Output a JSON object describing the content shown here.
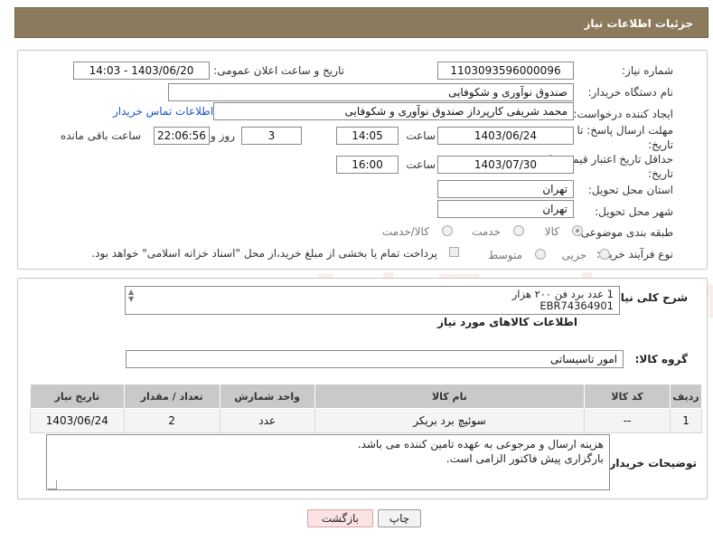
{
  "header": {
    "title": "جزئیات اطلاعات نیاز"
  },
  "form": {
    "need_number_label": "شماره نیاز:",
    "need_number": "1103093596000096",
    "announce_label": "تاریخ و ساعت اعلان عمومی:",
    "announce_value": "1403/06/20 - 14:03",
    "buyer_org_label": "نام دستگاه خریدار:",
    "buyer_org": "صندوق نوآوری و شکوفایی",
    "creator_label": "ایجاد کننده درخواست:",
    "creator": "محمد  شریفی کارپرداز صندوق نوآوری و شکوفایی",
    "contact_link": "اطلاعات تماس خریدار",
    "reply_deadline_label_1": "مهلت ارسال پاسخ: تا",
    "reply_deadline_label_2": "تاریخ:",
    "reply_date": "1403/06/24",
    "time_label": "ساعت",
    "reply_time": "14:05",
    "days_value": "3",
    "days_label": "روز و",
    "remaining_time": "22:06:56",
    "remaining_label": "ساعت باقی مانده",
    "price_deadline_label_1": "حداقل تاریخ اعتبار قیمت: تا",
    "price_deadline_label_2": "تاریخ:",
    "price_date": "1403/07/30",
    "price_time_label": "ساعت",
    "price_time": "16:00",
    "province_label": "استان محل تحویل:",
    "province": "تهران",
    "city_label": "شهر محل تحویل:",
    "city": "تهران",
    "category_label": "طبقه بندی موضوعی:",
    "category_options": [
      "کالا",
      "خدمت",
      "کالا/خدمت"
    ],
    "category_selected": "کالا",
    "purchase_type_label": "نوع فرآیند خرید :",
    "purchase_options": [
      "جزیی",
      "متوسط"
    ],
    "payment_note": "پرداخت تمام یا بخشی از مبلغ خرید،از محل \"اسناد خزانه اسلامی\" خواهد بود."
  },
  "watermark": "AriaTender.neT",
  "description": {
    "label": "شرح کلی نیاز:",
    "text": "1 عدد برد فن ۲۰۰ هزار\nEBR74364901"
  },
  "goods": {
    "section_title": "اطلاعات کالاهای مورد نیاز",
    "group_label": "گروه کالا:",
    "group_value": "امور تاسیساتی",
    "columns": [
      "ردیف",
      "کد کالا",
      "نام کالا",
      "واحد شمارش",
      "تعداد / مقدار",
      "تاریخ نیاز"
    ],
    "rows": [
      {
        "row": "1",
        "code": "--",
        "name": "سوئیچ برد بریکر",
        "unit": "عدد",
        "qty": "2",
        "date": "1403/06/24"
      }
    ]
  },
  "buyer_notes": {
    "label": "توضیحات خریدار:",
    "text": "هزینه ارسال و مرجوعی به عهده تامین کننده می باشد.\nبارگزاری پیش فاکتور الزامی است."
  },
  "buttons": {
    "print": "چاپ",
    "back": "بازگشت"
  }
}
